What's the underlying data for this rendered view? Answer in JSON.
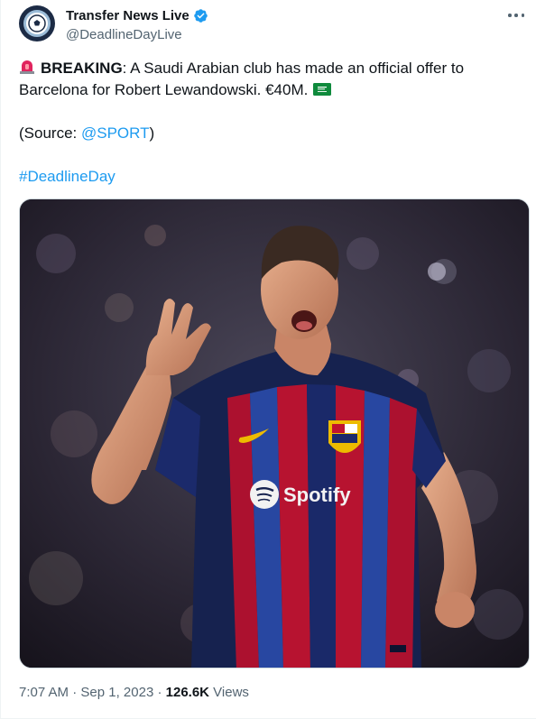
{
  "account": {
    "display_name": "Transfer News Live",
    "handle": "@DeadlineDayLive",
    "verified": true
  },
  "post": {
    "lines": [
      {
        "bold": "BREAKING",
        "rest": ": A Saudi Arabian club has made an official offer to"
      },
      {
        "text": "Barcelona for Robert Lewandowski. €40M."
      }
    ],
    "source_prefix": "(Source: ",
    "source_link": "@SPORT",
    "source_suffix": ")",
    "hashtag": "#DeadlineDay",
    "icons": [
      "siren-emoji",
      "saudi-flag-emoji"
    ]
  },
  "media": {
    "jersey_sponsor": "Spotify"
  },
  "meta": {
    "time": "7:07 AM",
    "separator": " · ",
    "date": "Sep 1, 2023",
    "views_count": "126.6K",
    "views_label": " Views"
  },
  "colors": {
    "link": "#1d9bf0",
    "secondary_text": "#536471",
    "verified": "#1d9bf0"
  }
}
